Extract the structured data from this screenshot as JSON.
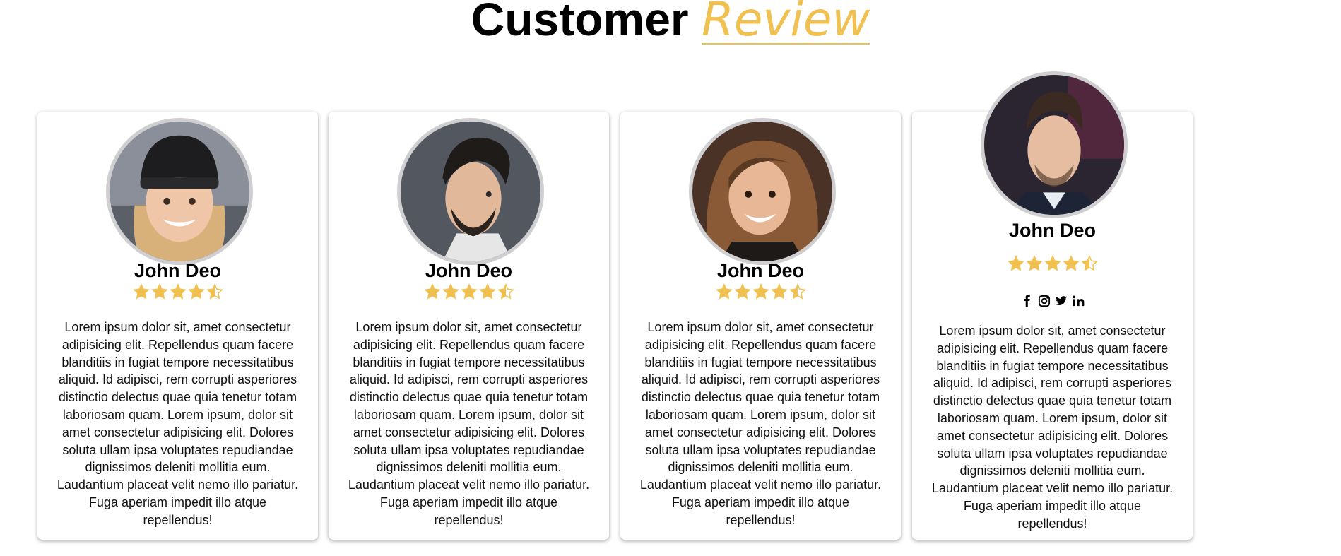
{
  "header": {
    "title_main": "Customer",
    "title_accent": "Review"
  },
  "colors": {
    "accent": "#f0c050",
    "card_bg": "#ffffff",
    "avatar_border": "#cfcfd2"
  },
  "reviews": [
    {
      "name": "John Deo",
      "rating": 4.5,
      "avatar_icon": "avatar-woman-beanie",
      "text": "Lorem ipsum dolor sit, amet consectetur adipisicing elit. Repellendus quam facere blanditiis in fugiat tempore necessitatibus aliquid. Id adipisci, rem corrupti asperiores distinctio delectus quae quia tenetur totam laboriosam quam. Lorem ipsum, dolor sit amet consectetur adipisicing elit. Dolores soluta ullam ipsa voluptates repudiandae dignissimos deleniti mollitia eum. Laudantium placeat velit nemo illo pariatur. Fuga aperiam impedit illo atque repellendus!"
    },
    {
      "name": "John Deo",
      "rating": 4.5,
      "avatar_icon": "avatar-man-beard",
      "text": "Lorem ipsum dolor sit, amet consectetur adipisicing elit. Repellendus quam facere blanditiis in fugiat tempore necessitatibus aliquid. Id adipisci, rem corrupti asperiores distinctio delectus quae quia tenetur totam laboriosam quam. Lorem ipsum, dolor sit amet consectetur adipisicing elit. Dolores soluta ullam ipsa voluptates repudiandae dignissimos deleniti mollitia eum. Laudantium placeat velit nemo illo pariatur. Fuga aperiam impedit illo atque repellendus!"
    },
    {
      "name": "John Deo",
      "rating": 4.5,
      "avatar_icon": "avatar-woman-curly",
      "text": "Lorem ipsum dolor sit, amet consectetur adipisicing elit. Repellendus quam facere blanditiis in fugiat tempore necessitatibus aliquid. Id adipisci, rem corrupti asperiores distinctio delectus quae quia tenetur totam laboriosam quam. Lorem ipsum, dolor sit amet consectetur adipisicing elit. Dolores soluta ullam ipsa voluptates repudiandae dignissimos deleniti mollitia eum. Laudantium placeat velit nemo illo pariatur. Fuga aperiam impedit illo atque repellendus!"
    },
    {
      "name": "John Deo",
      "rating": 4.5,
      "avatar_icon": "avatar-man-suit",
      "socials": [
        "facebook-icon",
        "instagram-icon",
        "twitter-icon",
        "linkedin-icon"
      ],
      "text": "Lorem ipsum dolor sit, amet consectetur adipisicing elit. Repellendus quam facere blanditiis in fugiat tempore necessitatibus aliquid. Id adipisci, rem corrupti asperiores distinctio delectus quae quia tenetur totam laboriosam quam. Lorem ipsum, dolor sit amet consectetur adipisicing elit. Dolores soluta ullam ipsa voluptates repudiandae dignissimos deleniti mollitia eum. Laudantium placeat velit nemo illo pariatur. Fuga aperiam impedit illo atque repellendus!"
    }
  ]
}
